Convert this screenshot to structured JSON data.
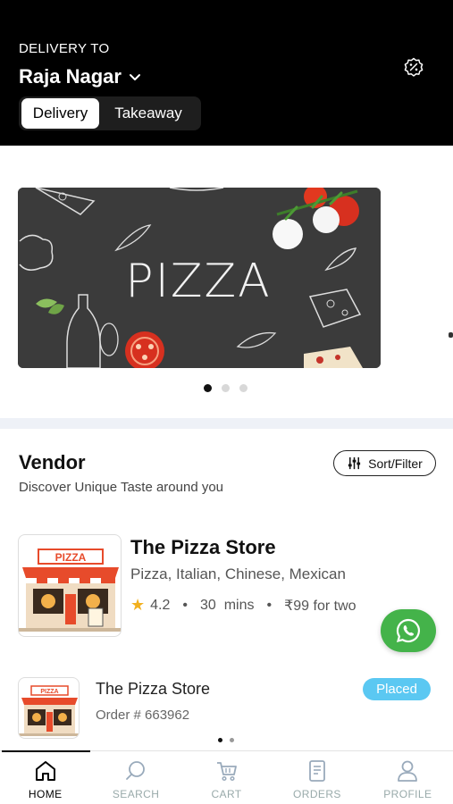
{
  "header": {
    "delivery_to_label": "DELIVERY TO",
    "location": "Raja Nagar",
    "location_icon": "chevron-down-icon",
    "offers_icon": "percent-badge-icon",
    "modes": [
      "Delivery",
      "Takeaway"
    ],
    "selected_mode": "Delivery"
  },
  "banner": {
    "text": "PIZZA",
    "slides_count": 3,
    "active_slide": 1
  },
  "vendor_section": {
    "title": "Vendor",
    "subtitle": "Discover Unique Taste around you",
    "sort_filter_label": "Sort/Filter",
    "sort_filter_icon": "sliders-icon"
  },
  "vendors": [
    {
      "name": "The Pizza Store",
      "cuisine": "Pizza, Italian, Chinese, Mexican",
      "rating": "4.2",
      "delivery_time": "30  mins",
      "price_for_two": "₹99 for two",
      "sign_text": "PIZZA"
    }
  ],
  "recent_order": {
    "name": "The Pizza Store",
    "order_number": "Order # 663962",
    "status": "Placed",
    "sign_text": "PIZZA"
  },
  "whatsapp_icon": "whatsapp-icon",
  "bottom_nav": {
    "active": "home",
    "home": "HOME",
    "search": "SEARCH",
    "cart": "CART",
    "orders": "ORDERS",
    "profile": "PROFILE"
  },
  "colors": {
    "header_bg": "#000000",
    "whatsapp_green": "#44b34a",
    "status_blue": "#5bc8f2",
    "rating_star": "#f2b01e",
    "banner_bg": "#3b3b3b"
  }
}
